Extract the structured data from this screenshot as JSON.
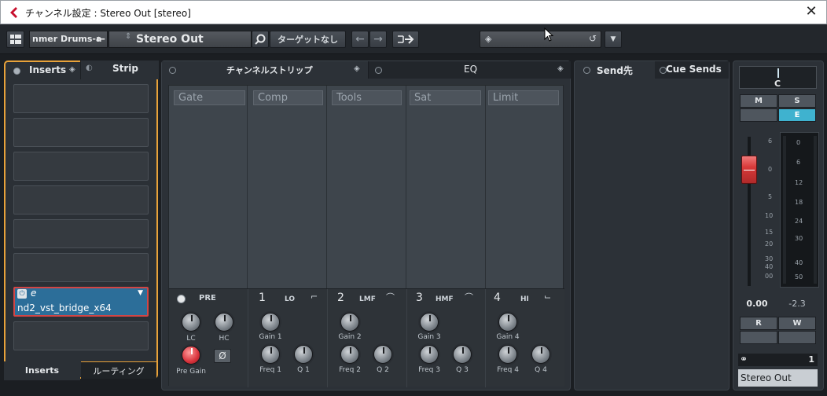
{
  "window": {
    "title": "チャンネル設定 : Stereo Out [stereo]",
    "close": "✕"
  },
  "toolbar": {
    "prev_channel": "nmer Drums-a",
    "channel_name": "Stereo Out",
    "target_label": "ターゲットなし"
  },
  "inserts": {
    "tab_inserts": "Inserts",
    "tab_strip": "Strip",
    "plugin_name": "nd2_vst_bridge_x64",
    "bottom_tab_inserts": "Inserts",
    "bottom_tab_routing": "ルーティング"
  },
  "strip": {
    "tab_channelstrip": "チャンネルストリップ",
    "tab_eq": "EQ",
    "modules": [
      "Gate",
      "Comp",
      "Tools",
      "Sat",
      "Limit"
    ],
    "pre_label": "PRE",
    "lc": "LC",
    "hc": "HC",
    "pre_gain": "Pre Gain",
    "bands": [
      {
        "num": "1",
        "name": "LO",
        "gain": "Gain 1",
        "freq": "Freq 1",
        "q": "Q 1"
      },
      {
        "num": "2",
        "name": "LMF",
        "gain": "Gain 2",
        "freq": "Freq 2",
        "q": "Q 2"
      },
      {
        "num": "3",
        "name": "HMF",
        "gain": "Gain 3",
        "freq": "Freq 3",
        "q": "Q 3"
      },
      {
        "num": "4",
        "name": "HI",
        "gain": "Gain 4",
        "freq": "Freq 4",
        "q": "Q 4"
      }
    ]
  },
  "sends": {
    "tab_send": "Send先",
    "tab_cue": "Cue Sends"
  },
  "fader": {
    "pan": "C",
    "m": "M",
    "s": "S",
    "e": "E",
    "fader_scale": [
      "6",
      "0",
      "5",
      "10",
      "15",
      "20",
      "30",
      "40",
      "00"
    ],
    "meter_scale": [
      "0",
      "6",
      "12",
      "18",
      "24",
      "30",
      "40",
      "50"
    ],
    "volume": "0.00",
    "peak": "-2.3",
    "r": "R",
    "w": "W",
    "output_num": "1",
    "output_name": "Stereo Out",
    "colors": {
      "accent": "#e8a23a",
      "edit": "#3fb2cf",
      "fader_cap": "#d83a3a"
    }
  }
}
